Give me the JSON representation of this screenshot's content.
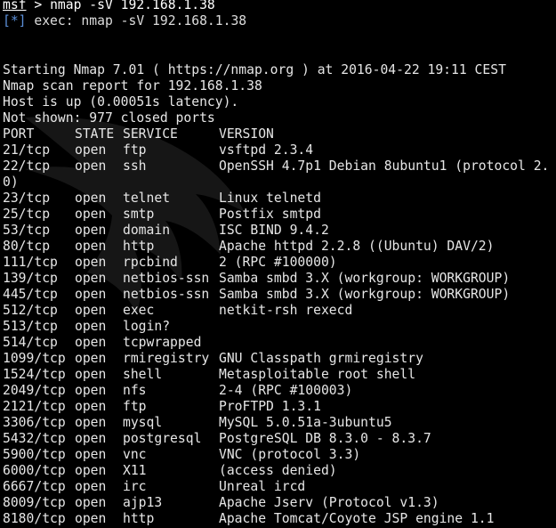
{
  "prompt": {
    "app": "msf",
    "arrow": ">",
    "command": "nmap -sV 192.168.1.38"
  },
  "exec_line": {
    "marker": "[*]",
    "text": "exec: nmap -sV 192.168.1.38"
  },
  "scan_info": {
    "starting": "Starting Nmap 7.01 ( https://nmap.org ) at 2016-04-22 19:11 CEST",
    "report": "Nmap scan report for 192.168.1.38",
    "host_status": "Host is up (0.00051s latency).",
    "not_shown": "Not shown: 977 closed ports"
  },
  "table": {
    "headers": [
      "PORT",
      "STATE",
      "SERVICE",
      "VERSION"
    ],
    "rows": [
      {
        "port": "21/tcp",
        "state": "open",
        "service": "ftp",
        "version": "vsftpd 2.3.4"
      },
      {
        "port": "22/tcp",
        "state": "open",
        "service": "ssh",
        "version": "OpenSSH 4.7p1 Debian 8ubuntu1 (protocol 2."
      },
      {
        "port": "0)",
        "state": "",
        "service": "",
        "version": ""
      },
      {
        "port": "23/tcp",
        "state": "open",
        "service": "telnet",
        "version": "Linux telnetd"
      },
      {
        "port": "25/tcp",
        "state": "open",
        "service": "smtp",
        "version": "Postfix smtpd"
      },
      {
        "port": "53/tcp",
        "state": "open",
        "service": "domain",
        "version": "ISC BIND 9.4.2"
      },
      {
        "port": "80/tcp",
        "state": "open",
        "service": "http",
        "version": "Apache httpd 2.2.8 ((Ubuntu) DAV/2)"
      },
      {
        "port": "111/tcp",
        "state": "open",
        "service": "rpcbind",
        "version": "2 (RPC #100000)"
      },
      {
        "port": "139/tcp",
        "state": "open",
        "service": "netbios-ssn",
        "version": "Samba smbd 3.X (workgroup: WORKGROUP)"
      },
      {
        "port": "445/tcp",
        "state": "open",
        "service": "netbios-ssn",
        "version": "Samba smbd 3.X (workgroup: WORKGROUP)"
      },
      {
        "port": "512/tcp",
        "state": "open",
        "service": "exec",
        "version": "netkit-rsh rexecd"
      },
      {
        "port": "513/tcp",
        "state": "open",
        "service": "login?",
        "version": ""
      },
      {
        "port": "514/tcp",
        "state": "open",
        "service": "tcpwrapped",
        "version": ""
      },
      {
        "port": "1099/tcp",
        "state": "open",
        "service": "rmiregistry",
        "version": "GNU Classpath grmiregistry"
      },
      {
        "port": "1524/tcp",
        "state": "open",
        "service": "shell",
        "version": "Metasploitable root shell"
      },
      {
        "port": "2049/tcp",
        "state": "open",
        "service": "nfs",
        "version": "2-4 (RPC #100003)"
      },
      {
        "port": "2121/tcp",
        "state": "open",
        "service": "ftp",
        "version": "ProFTPD 1.3.1"
      },
      {
        "port": "3306/tcp",
        "state": "open",
        "service": "mysql",
        "version": "MySQL 5.0.51a-3ubuntu5"
      },
      {
        "port": "5432/tcp",
        "state": "open",
        "service": "postgresql",
        "version": "PostgreSQL DB 8.3.0 - 8.3.7"
      },
      {
        "port": "5900/tcp",
        "state": "open",
        "service": "vnc",
        "version": "VNC (protocol 3.3)"
      },
      {
        "port": "6000/tcp",
        "state": "open",
        "service": "X11",
        "version": "(access denied)"
      },
      {
        "port": "6667/tcp",
        "state": "open",
        "service": "irc",
        "version": "Unreal ircd"
      },
      {
        "port": "8009/tcp",
        "state": "open",
        "service": "ajp13",
        "version": "Apache Jserv (Protocol v1.3)"
      },
      {
        "port": "8180/tcp",
        "state": "open",
        "service": "http",
        "version": "Apache Tomcat/Coyote JSP engine 1.1"
      }
    ]
  },
  "colors": {
    "background": "#000000",
    "text": "#e6e6e6",
    "exec_marker": "#5b8fd8"
  }
}
